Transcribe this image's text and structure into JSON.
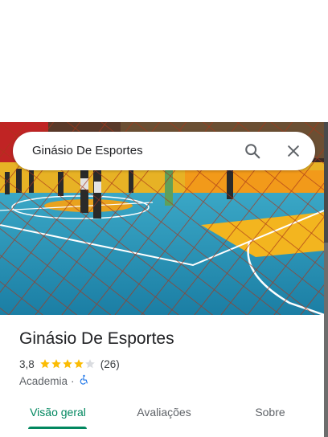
{
  "search": {
    "query": "Ginásio De Esportes"
  },
  "icons": {
    "search": "search-icon",
    "close": "close-icon",
    "star_full": "star-icon",
    "star_empty": "star-empty-icon",
    "accessibility": "wheelchair-icon"
  },
  "place": {
    "name": "Ginásio De Esportes",
    "rating": "3,8",
    "stars_value": 3.8,
    "stars_max": 5,
    "review_count": "(26)",
    "category": "Academia",
    "separator": "·"
  },
  "tabs": [
    {
      "label": "Visão geral",
      "active": true
    },
    {
      "label": "Avaliações",
      "active": false
    },
    {
      "label": "Sobre",
      "active": false
    }
  ],
  "colors": {
    "accent": "#01875f",
    "star": "#fbbc04",
    "star_empty": "#dadce0",
    "accessibility_icon": "#1a73e8",
    "court_blue": "#1f8fb3",
    "court_orange": "#f0a21c",
    "net": "#b83a1a"
  }
}
